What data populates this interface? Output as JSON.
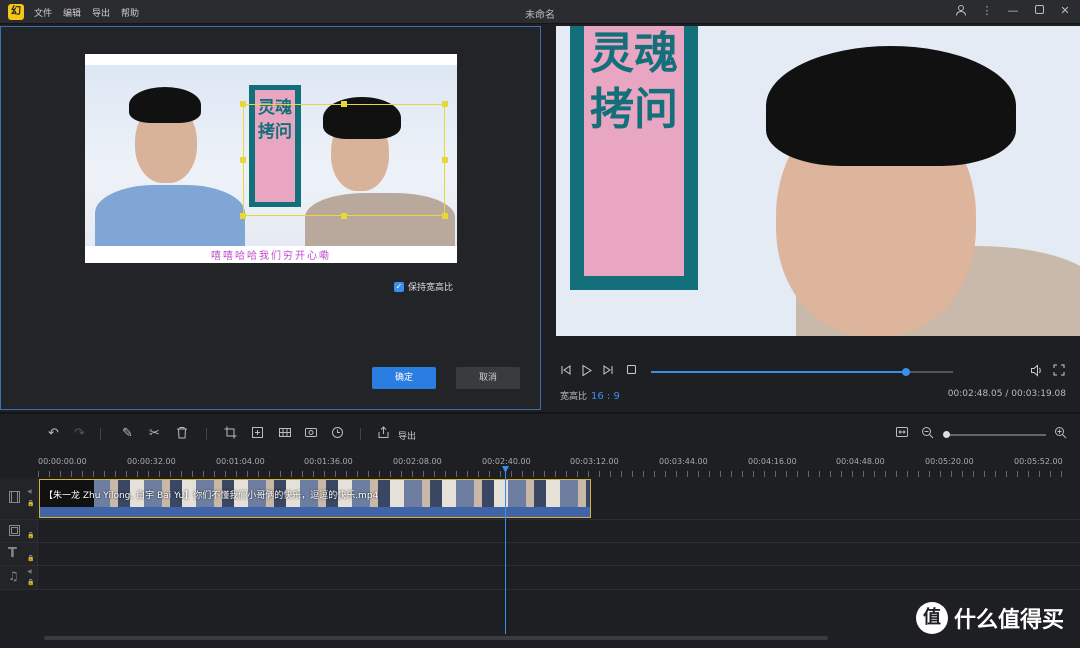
{
  "titlebar": {
    "logo": "幻",
    "menu": [
      "文件",
      "编辑",
      "导出",
      "帮助"
    ],
    "title": "未命名",
    "controls": {
      "user": "user-icon",
      "more": "more-icon",
      "minimize": "minimize-icon",
      "maximize": "maximize-icon",
      "close": "close-icon"
    }
  },
  "crop": {
    "banner_text": "灵魂拷问",
    "caption": "嘻嘻哈哈我们穷开心嘞",
    "keep_ratio_label": "保持宽高比",
    "keep_ratio_checked": true,
    "ok_label": "确定",
    "cancel_label": "取消"
  },
  "preview": {
    "banner_text": "灵魂拷问",
    "ratio_label": "宽高比",
    "ratio_value": "16 : 9",
    "time": "00:02:48.05 / 00:03:19.08",
    "progress": 0.845
  },
  "toolbar": {
    "export_label": "导出"
  },
  "ruler": {
    "ticks": [
      "00:00:00.00",
      "00:00:32.00",
      "00:01:04.00",
      "00:01:36.00",
      "00:02:08.00",
      "00:02:40.00",
      "00:03:12.00",
      "00:03:44.00",
      "00:04:16.00",
      "00:04:48.00",
      "00:05:20.00",
      "00:05:52.00"
    ]
  },
  "timeline": {
    "clip_title": "【朱一龙 Zhu Yilong, 白宇 Bai Yu】你们不懂我们小哥俩的快乐，逗逗的快乐.mp4"
  },
  "watermark": {
    "badge": "值",
    "text": "什么值得买"
  }
}
